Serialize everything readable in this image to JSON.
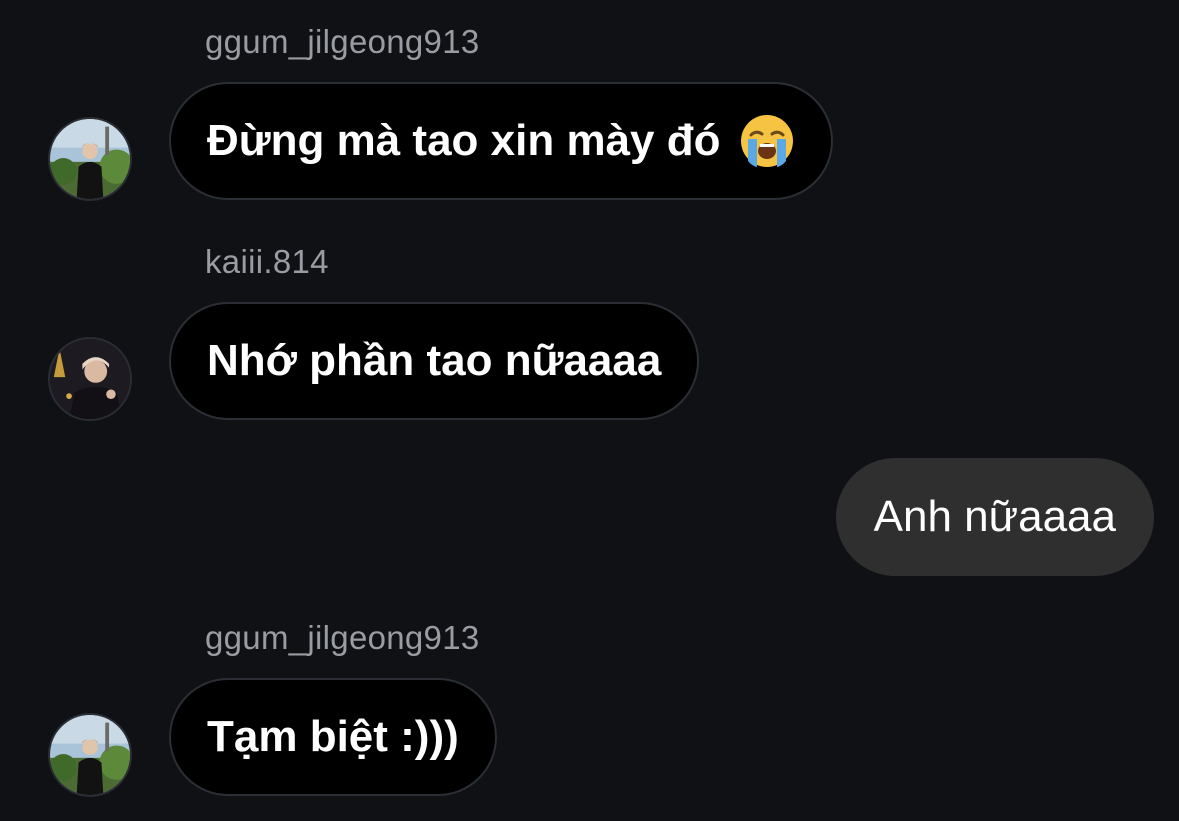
{
  "messages": [
    {
      "sender": "ggum_jilgeong913",
      "text": "Đừng mà tao xin mày đó",
      "emoji": "loudly-crying-face-icon",
      "direction": "incoming"
    },
    {
      "sender": "kaiii.814",
      "text": "Nhớ phần tao nữaaaa",
      "direction": "incoming"
    },
    {
      "text": "Anh nữaaaa",
      "direction": "outgoing"
    },
    {
      "sender": "ggum_jilgeong913",
      "text": "Tạm biệt :)))",
      "direction": "incoming"
    }
  ],
  "colors": {
    "background": "#0f1115",
    "incoming_bubble": "#000000",
    "incoming_border": "#2b2e34",
    "outgoing_bubble": "#2f2f30",
    "sender_name": "#9a9ca3"
  }
}
